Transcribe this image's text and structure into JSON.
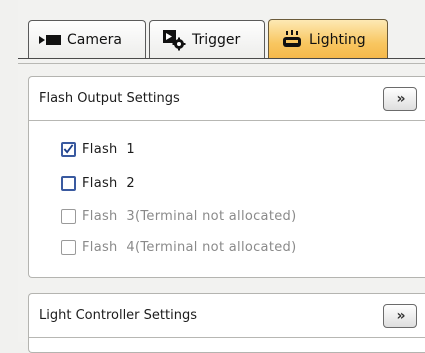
{
  "tabs": [
    {
      "label": "Camera",
      "icon": "camera-icon",
      "active": false
    },
    {
      "label": "Trigger",
      "icon": "trigger-gear-icon",
      "active": false
    },
    {
      "label": "Lighting",
      "icon": "lighting-icon",
      "active": true
    }
  ],
  "flash_section": {
    "title": "Flash Output Settings",
    "expand_label": "»",
    "items": [
      {
        "label": "Flash  1",
        "checked": true,
        "enabled": true
      },
      {
        "label": "Flash  2",
        "checked": false,
        "enabled": true
      },
      {
        "label": "Flash  3(Terminal not allocated)",
        "checked": false,
        "enabled": false
      },
      {
        "label": "Flash  4(Terminal not allocated)",
        "checked": false,
        "enabled": false
      }
    ]
  },
  "light_section": {
    "title": "Light Controller Settings",
    "expand_label": "»"
  },
  "colors": {
    "active_tab": "#f8c660",
    "checkbox_border": "#3a5aa0",
    "disabled_text": "#8a8a8a"
  }
}
